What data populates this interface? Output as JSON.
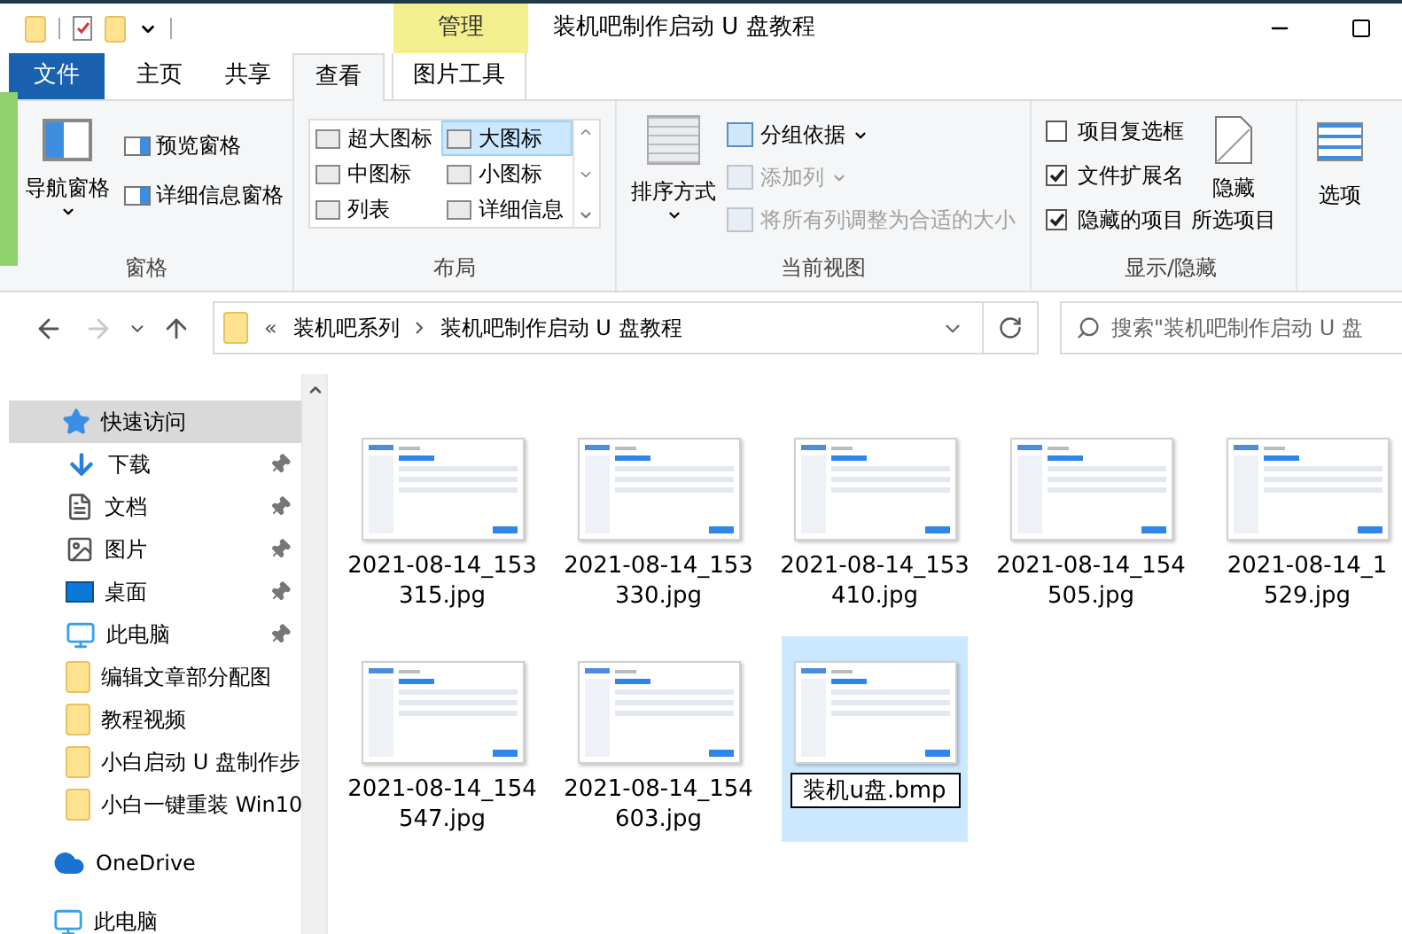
{
  "window": {
    "title": "装机吧制作启动 U 盘教程",
    "context_label": "管理"
  },
  "tabs": [
    {
      "label": "文件",
      "kind": "file",
      "selected": false
    },
    {
      "label": "主页",
      "kind": "tab",
      "selected": false
    },
    {
      "label": "共享",
      "kind": "tab",
      "selected": false
    },
    {
      "label": "查看",
      "kind": "tab",
      "selected": true
    },
    {
      "label": "图片工具",
      "kind": "context",
      "selected": false
    }
  ],
  "ribbon": {
    "panes": {
      "label": "窗格",
      "navigation_pane": "导航窗格",
      "preview_pane": "预览窗格",
      "details_pane": "详细信息窗格"
    },
    "layout": {
      "label": "布局",
      "options": [
        {
          "label": "超大图标",
          "selected": false
        },
        {
          "label": "大图标",
          "selected": true
        },
        {
          "label": "中图标",
          "selected": false
        },
        {
          "label": "小图标",
          "selected": false
        },
        {
          "label": "列表",
          "selected": false
        },
        {
          "label": "详细信息",
          "selected": false
        }
      ]
    },
    "current_view": {
      "label": "当前视图",
      "sort_by": "排序方式",
      "group_by": {
        "label": "分组依据",
        "disabled": false
      },
      "add_columns": {
        "label": "添加列",
        "disabled": true
      },
      "size_columns": {
        "label": "将所有列调整为合适的大小",
        "disabled": true
      }
    },
    "show_hide": {
      "label": "显示/隐藏",
      "checkboxes": [
        {
          "label": "项目复选框",
          "checked": false
        },
        {
          "label": "文件扩展名",
          "checked": true
        },
        {
          "label": "隐藏的项目",
          "checked": true
        }
      ],
      "hide_selected": [
        "隐藏",
        "所选项目"
      ]
    },
    "options": {
      "label": "选项"
    }
  },
  "nav_buttons": [
    {
      "kind": "back",
      "disabled": false
    },
    {
      "kind": "forward",
      "disabled": true
    },
    {
      "kind": "recent",
      "disabled": false
    },
    {
      "kind": "up",
      "disabled": false
    }
  ],
  "address": {
    "overflow": "«",
    "path": [
      "装机吧系列",
      "装机吧制作启动 U 盘教程"
    ]
  },
  "search": {
    "placeholder": "搜索\"装机吧制作启动 U 盘"
  },
  "sidebar": [
    {
      "label": "快速访问",
      "kind": "star",
      "selected": true,
      "children": [
        {
          "label": "下载",
          "kind": "download",
          "selected": false,
          "pinned": true
        },
        {
          "label": "文档",
          "kind": "document",
          "selected": false,
          "pinned": true
        },
        {
          "label": "图片",
          "kind": "picture",
          "selected": false,
          "pinned": true
        },
        {
          "label": "桌面",
          "kind": "desktop",
          "selected": false,
          "pinned": true
        },
        {
          "label": "此电脑",
          "kind": "computer",
          "selected": false,
          "pinned": true
        },
        {
          "label": "编辑文章部分配图",
          "kind": "folder",
          "selected": false,
          "pinned": false
        },
        {
          "label": "教程视频",
          "kind": "folder",
          "selected": false,
          "pinned": false
        },
        {
          "label": "小白启动 U 盘制作步",
          "kind": "folder",
          "selected": false,
          "pinned": false
        },
        {
          "label": "小白一键重装 Win10",
          "kind": "folder",
          "selected": false,
          "pinned": false
        }
      ]
    },
    {
      "label": "OneDrive",
      "kind": "cloud",
      "selected": false
    },
    {
      "label": "此电脑",
      "kind": "computer",
      "selected": false
    }
  ],
  "files": [
    {
      "name_lines": [
        "2021-08-14_153",
        "315.jpg"
      ],
      "selected": false,
      "renaming": false
    },
    {
      "name_lines": [
        "2021-08-14_153",
        "330.jpg"
      ],
      "selected": false,
      "renaming": false
    },
    {
      "name_lines": [
        "2021-08-14_153",
        "410.jpg"
      ],
      "selected": false,
      "renaming": false
    },
    {
      "name_lines": [
        "2021-08-14_154",
        "505.jpg"
      ],
      "selected": false,
      "renaming": false
    },
    {
      "name_lines": [
        "2021-08-14_1",
        "529.jpg"
      ],
      "selected": false,
      "renaming": false
    },
    {
      "name_lines": [
        "2021-08-14_154",
        "547.jpg"
      ],
      "selected": false,
      "renaming": false
    },
    {
      "name_lines": [
        "2021-08-14_154",
        "603.jpg"
      ],
      "selected": false,
      "renaming": false
    },
    {
      "name_lines": [
        "装机u盘.bmp"
      ],
      "selected": true,
      "renaming": true
    }
  ]
}
